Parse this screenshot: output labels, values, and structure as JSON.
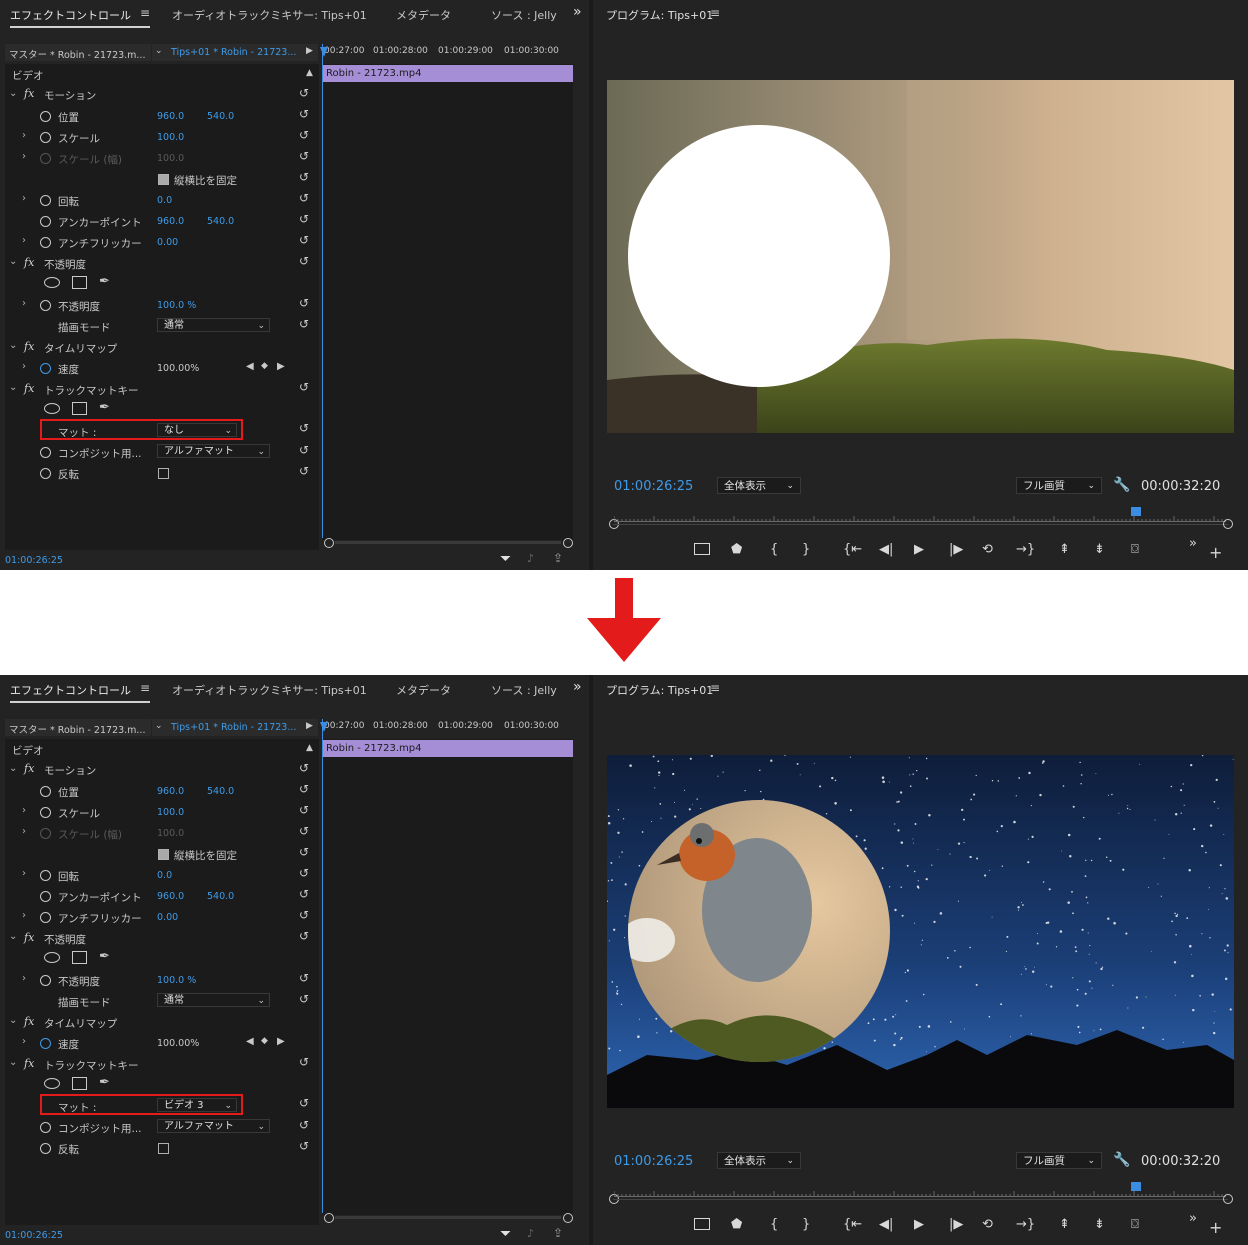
{
  "panels": [
    {
      "tabs": {
        "effect_controls": "エフェクトコントロール",
        "audio_mixer": "オーディオトラックミキサー: Tips+01",
        "metadata": "メタデータ",
        "source": "ソース : Jelly",
        "overflow": "»"
      },
      "header": {
        "master": "マスター * Robin - 21723.m...",
        "sequence": "Tips+01 * Robin - 21723...",
        "ruler": [
          "00:27:00",
          "01:00:28:00",
          "01:00:29:00",
          "01:00:30:00"
        ]
      },
      "section_video": "ビデオ",
      "clip_name": "Robin - 21723.mp4",
      "motion": {
        "title": "モーション",
        "position_label": "位置",
        "position_x": "960.0",
        "position_y": "540.0",
        "scale_label": "スケール",
        "scale_value": "100.0",
        "scale_width_label": "スケール (幅)",
        "scale_width_value": "100.0",
        "uniform_scale_label": "縦横比を固定",
        "rotation_label": "回転",
        "rotation_value": "0.0",
        "anchor_label": "アンカーポイント",
        "anchor_x": "960.0",
        "anchor_y": "540.0",
        "antiflicker_label": "アンチフリッカー",
        "antiflicker_value": "0.00"
      },
      "opacity": {
        "title": "不透明度",
        "opacity_label": "不透明度",
        "opacity_value": "100.0 %",
        "blend_label": "描画モード",
        "blend_value": "通常"
      },
      "time_remap": {
        "title": "タイムリマップ",
        "speed_label": "速度",
        "speed_value": "100.00%"
      },
      "track_matte": {
        "title": "トラックマットキー",
        "matte_label": "マット :",
        "matte_value": "なし",
        "composite_label": "コンポジット用...",
        "composite_value": "アルファマット",
        "reverse_label": "反転"
      },
      "bottom_timecode": "01:00:26:25",
      "program": {
        "title": "プログラム: Tips+01",
        "timecode": "01:00:26:25",
        "zoom": "全体表示",
        "quality": "フル画質",
        "duration": "00:00:32:20",
        "scene": "white-circle-over-moss"
      }
    },
    {
      "tabs": {
        "effect_controls": "エフェクトコントロール",
        "audio_mixer": "オーディオトラックミキサー: Tips+01",
        "metadata": "メタデータ",
        "source": "ソース : Jelly",
        "overflow": "»"
      },
      "header": {
        "master": "マスター * Robin - 21723.m...",
        "sequence": "Tips+01 * Robin - 21723...",
        "ruler": [
          "00:27:00",
          "01:00:28:00",
          "01:00:29:00",
          "01:00:30:00"
        ]
      },
      "section_video": "ビデオ",
      "clip_name": "Robin - 21723.mp4",
      "motion": {
        "title": "モーション",
        "position_label": "位置",
        "position_x": "960.0",
        "position_y": "540.0",
        "scale_label": "スケール",
        "scale_value": "100.0",
        "scale_width_label": "スケール (幅)",
        "scale_width_value": "100.0",
        "uniform_scale_label": "縦横比を固定",
        "rotation_label": "回転",
        "rotation_value": "0.0",
        "anchor_label": "アンカーポイント",
        "anchor_x": "960.0",
        "anchor_y": "540.0",
        "antiflicker_label": "アンチフリッカー",
        "antiflicker_value": "0.00"
      },
      "opacity": {
        "title": "不透明度",
        "opacity_label": "不透明度",
        "opacity_value": "100.0 %",
        "blend_label": "描画モード",
        "blend_value": "通常"
      },
      "time_remap": {
        "title": "タイムリマップ",
        "speed_label": "速度",
        "speed_value": "100.00%"
      },
      "track_matte": {
        "title": "トラックマットキー",
        "matte_label": "マット :",
        "matte_value": "ビデオ 3",
        "composite_label": "コンポジット用...",
        "composite_value": "アルファマット",
        "reverse_label": "反転"
      },
      "bottom_timecode": "01:00:26:25",
      "program": {
        "title": "プログラム: Tips+01",
        "timecode": "01:00:26:25",
        "zoom": "全体表示",
        "quality": "フル画質",
        "duration": "00:00:32:20",
        "scene": "robin-in-circle-over-night-sky"
      }
    }
  ],
  "colors": {
    "accent_blue": "#3e9be8",
    "clip_purple": "#a58ed6",
    "highlight_red": "#e31b1b",
    "panel_bg": "#232323"
  },
  "arrow_icon": "down-arrow-icon"
}
